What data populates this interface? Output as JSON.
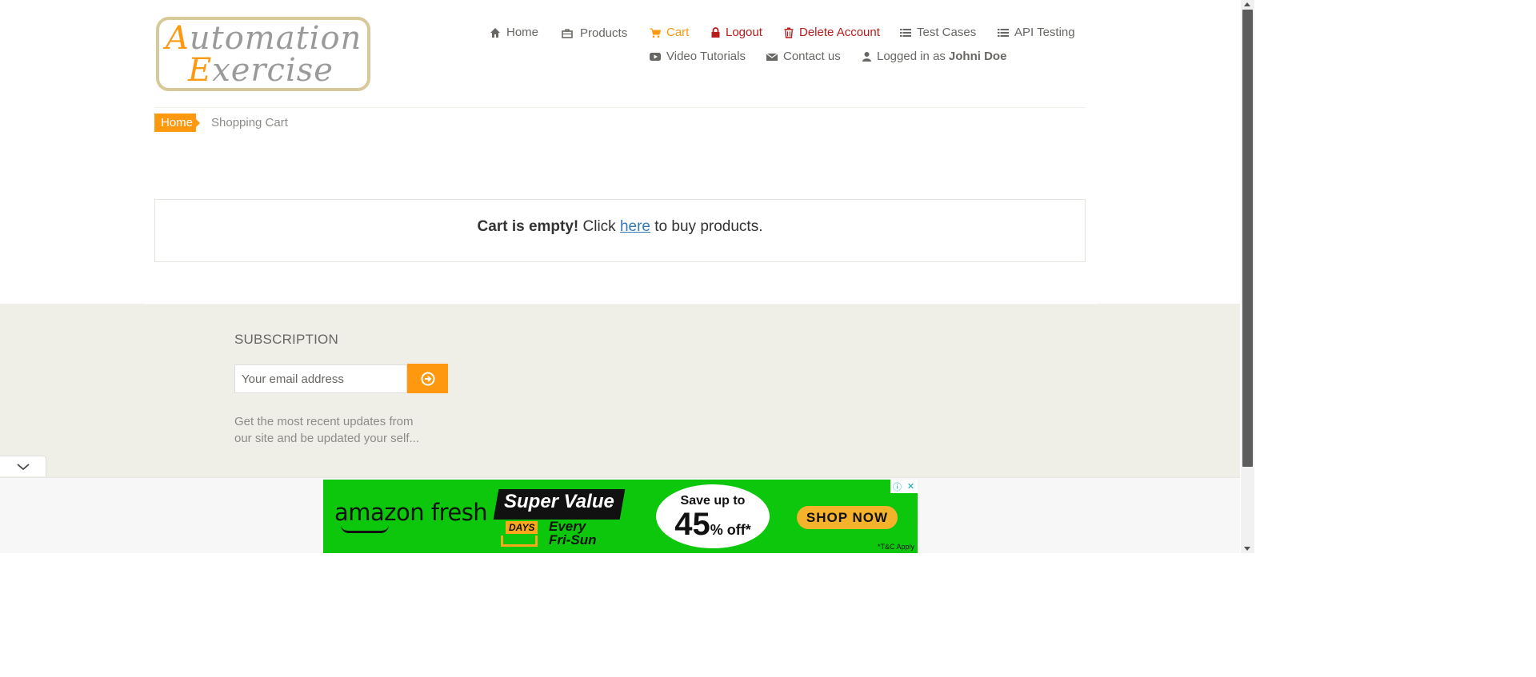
{
  "logo": {
    "line1_cap": "A",
    "line1_rest": "utomation",
    "line2_cap": "E",
    "line2_rest": "xercise"
  },
  "nav": {
    "home": "Home",
    "products": "Products",
    "cart": "Cart",
    "logout": "Logout",
    "delete_account": "Delete Account",
    "test_cases": "Test Cases",
    "api_testing": "API Testing",
    "video_tutorials": "Video Tutorials",
    "contact_us": "Contact us",
    "logged_in_prefix": "Logged in as",
    "logged_in_user": "Johni Doe"
  },
  "breadcrumb": {
    "home": "Home",
    "current": "Shopping Cart"
  },
  "cart": {
    "empty_bold": "Cart is empty!",
    "click": " Click ",
    "link": "here",
    "suffix": " to buy products."
  },
  "footer": {
    "subscription_title": "SUBSCRIPTION",
    "email_placeholder": "Your email address",
    "subscription_text": "Get the most recent updates from our site and be updated your self..."
  },
  "ad": {
    "brand": "amazon fresh",
    "super_value": "Super Value",
    "days": "DAYS",
    "every": "Every",
    "fri_sun": "Fri-Sun",
    "save_up_to": "Save up to",
    "percent": "45",
    "percent_sign": "%",
    "off": "off*",
    "shop_now": "SHOP NOW",
    "tc": "*T&C Apply"
  },
  "colors": {
    "accent": "#fe980f",
    "danger": "#b81c1c",
    "footer_bg": "#efeee7",
    "ad_green": "#0cc70c",
    "link": "#337ab7"
  },
  "icons": [
    "home-icon",
    "briefcase-icon",
    "cart-icon",
    "lock-icon",
    "trash-icon",
    "list-icon",
    "youtube-icon",
    "envelope-icon",
    "user-icon",
    "arrow-circle-right-icon",
    "chevron-down-icon",
    "info-icon",
    "close-icon"
  ]
}
